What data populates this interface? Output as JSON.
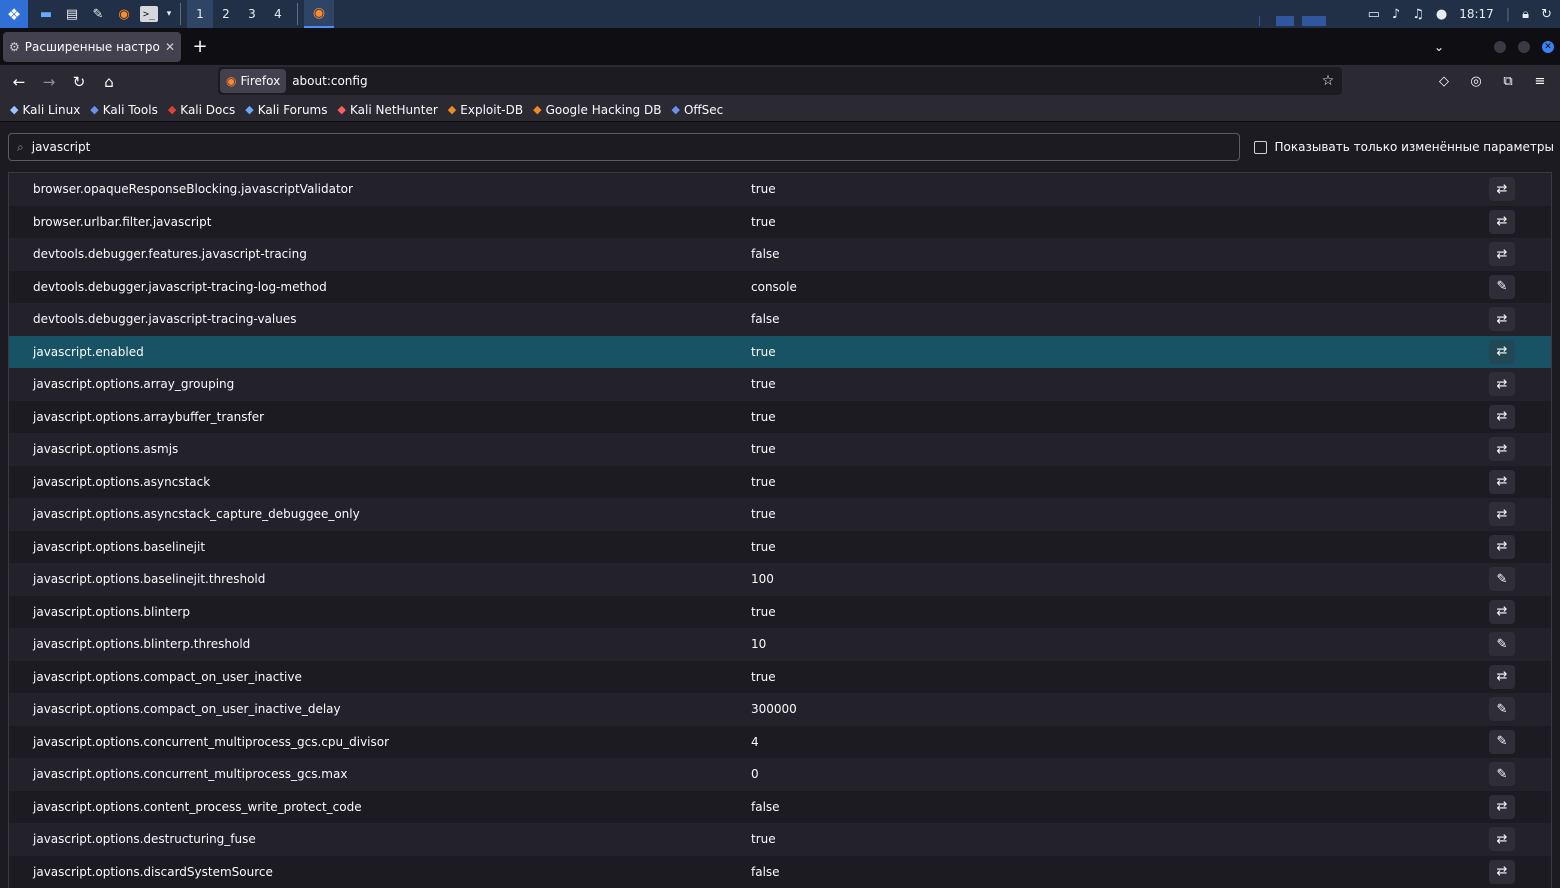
{
  "taskbar": {
    "workspaces": [
      "1",
      "2",
      "3",
      "4"
    ],
    "clock": "18:17"
  },
  "tab": {
    "title": "Расширенные настройки"
  },
  "urlbar": {
    "identity_label": "Firefox",
    "url": "about:config"
  },
  "bookmarks": [
    {
      "label": "Kali Linux",
      "icon": "kali-dragon-icon",
      "color": "#9ec3ff"
    },
    {
      "label": "Kali Tools",
      "icon": "kali-tools-icon",
      "color": "#6f8ff0"
    },
    {
      "label": "Kali Docs",
      "icon": "kali-docs-icon",
      "color": "#e0423a"
    },
    {
      "label": "Kali Forums",
      "icon": "kali-forums-icon",
      "color": "#6aa7ff"
    },
    {
      "label": "Kali NetHunter",
      "icon": "nethunter-icon",
      "color": "#ff5e5e"
    },
    {
      "label": "Exploit-DB",
      "icon": "exploit-db-icon",
      "color": "#f08a24"
    },
    {
      "label": "Google Hacking DB",
      "icon": "ghdb-icon",
      "color": "#f08a24"
    },
    {
      "label": "OffSec",
      "icon": "offsec-icon",
      "color": "#6f8ff0"
    }
  ],
  "search": {
    "value": "javascript",
    "modified_only_label": "Показывать только изменённые параметры"
  },
  "prefs": [
    {
      "name": "browser.opaqueResponseBlocking.javascriptValidator",
      "value": "true",
      "action": "toggle"
    },
    {
      "name": "browser.urlbar.filter.javascript",
      "value": "true",
      "action": "toggle"
    },
    {
      "name": "devtools.debugger.features.javascript-tracing",
      "value": "false",
      "action": "toggle"
    },
    {
      "name": "devtools.debugger.javascript-tracing-log-method",
      "value": "console",
      "action": "edit"
    },
    {
      "name": "devtools.debugger.javascript-tracing-values",
      "value": "false",
      "action": "toggle"
    },
    {
      "name": "javascript.enabled",
      "value": "true",
      "action": "toggle",
      "selected": true
    },
    {
      "name": "javascript.options.array_grouping",
      "value": "true",
      "action": "toggle"
    },
    {
      "name": "javascript.options.arraybuffer_transfer",
      "value": "true",
      "action": "toggle"
    },
    {
      "name": "javascript.options.asmjs",
      "value": "true",
      "action": "toggle"
    },
    {
      "name": "javascript.options.asyncstack",
      "value": "true",
      "action": "toggle"
    },
    {
      "name": "javascript.options.asyncstack_capture_debuggee_only",
      "value": "true",
      "action": "toggle"
    },
    {
      "name": "javascript.options.baselinejit",
      "value": "true",
      "action": "toggle"
    },
    {
      "name": "javascript.options.baselinejit.threshold",
      "value": "100",
      "action": "edit"
    },
    {
      "name": "javascript.options.blinterp",
      "value": "true",
      "action": "toggle"
    },
    {
      "name": "javascript.options.blinterp.threshold",
      "value": "10",
      "action": "edit"
    },
    {
      "name": "javascript.options.compact_on_user_inactive",
      "value": "true",
      "action": "toggle"
    },
    {
      "name": "javascript.options.compact_on_user_inactive_delay",
      "value": "300000",
      "action": "edit"
    },
    {
      "name": "javascript.options.concurrent_multiprocess_gcs.cpu_divisor",
      "value": "4",
      "action": "edit"
    },
    {
      "name": "javascript.options.concurrent_multiprocess_gcs.max",
      "value": "0",
      "action": "edit"
    },
    {
      "name": "javascript.options.content_process_write_protect_code",
      "value": "false",
      "action": "toggle"
    },
    {
      "name": "javascript.options.destructuring_fuse",
      "value": "true",
      "action": "toggle"
    },
    {
      "name": "javascript.options.discardSystemSource",
      "value": "false",
      "action": "toggle"
    }
  ],
  "colors": {
    "selected_row": "#185365",
    "accent": "#3b82f6"
  }
}
